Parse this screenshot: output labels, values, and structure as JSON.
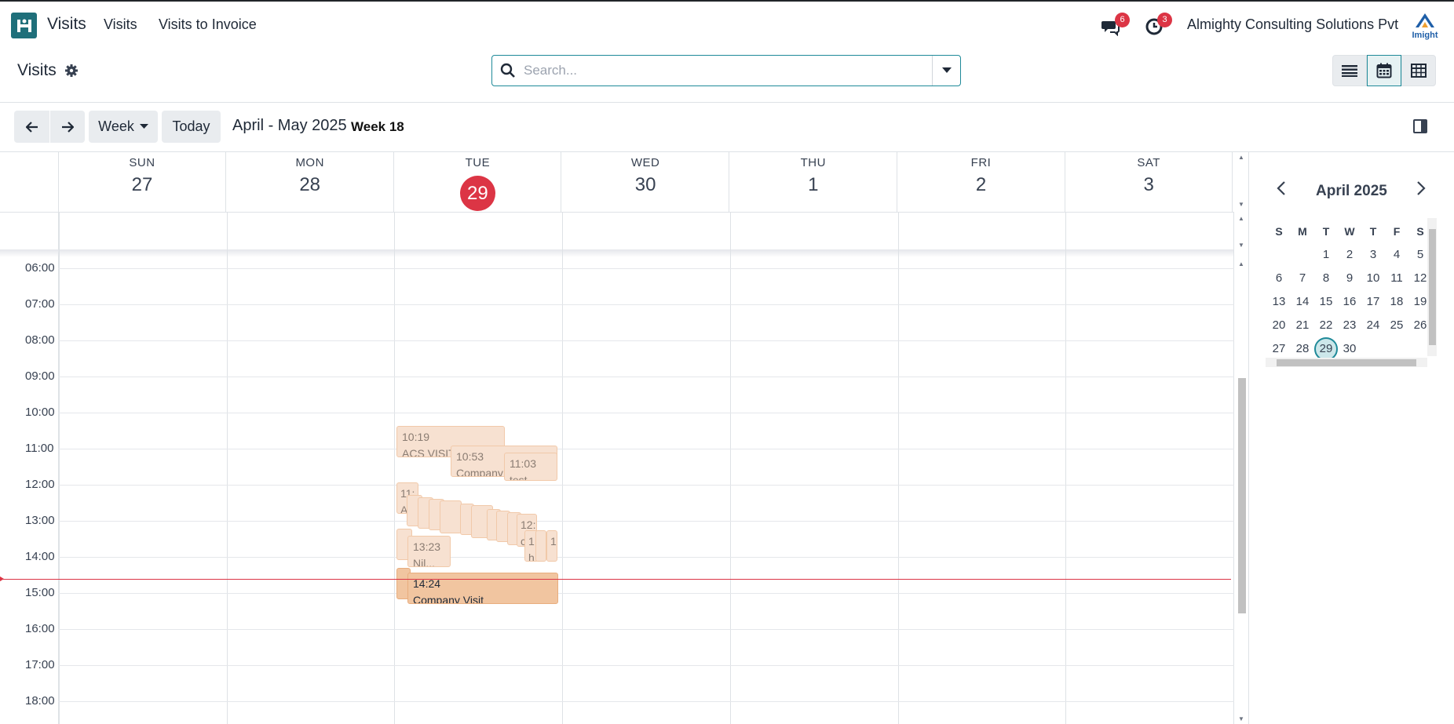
{
  "navbar": {
    "app_name": "Visits",
    "links": [
      "Visits",
      "Visits to Invoice"
    ],
    "messages_count": "6",
    "activities_count": "3",
    "company": "Almighty Consulting Solutions Pvt",
    "brand_text": "Imight"
  },
  "control_panel": {
    "title": "Visits",
    "search_placeholder": "Search..."
  },
  "toolbar": {
    "scale_label": "Week",
    "today_label": "Today",
    "range_title": "April - May 2025",
    "week_label": "Week 18"
  },
  "calendar": {
    "days": [
      {
        "name": "SUN",
        "num": "27"
      },
      {
        "name": "MON",
        "num": "28"
      },
      {
        "name": "TUE",
        "num": "29",
        "today": true
      },
      {
        "name": "WED",
        "num": "30"
      },
      {
        "name": "THU",
        "num": "1"
      },
      {
        "name": "FRI",
        "num": "2"
      },
      {
        "name": "SAT",
        "num": "3"
      }
    ],
    "hours": [
      "06:00",
      "07:00",
      "08:00",
      "09:00",
      "10:00",
      "11:00",
      "12:00",
      "13:00",
      "14:00",
      "15:00",
      "16:00",
      "17:00",
      "18:00"
    ],
    "events": {
      "e1_time": "10:19",
      "e1_title": "ACS VISIT",
      "e2_time": "10:53",
      "e2_title": "Company",
      "e3_time": "11:03",
      "e3_title": "test",
      "e4_time": "11:",
      "e4_title": "A",
      "e5_time": "13:23",
      "e5_title": "Nil...",
      "e6_time": "14:24",
      "e6_title": "Company Visit",
      "e7_time": "12:",
      "e7_title": "c",
      "e8_time": "1",
      "e8_title": "n",
      "e9_time": "1",
      "e9_title": "h"
    }
  },
  "mini_calendar": {
    "title": "April 2025",
    "dows": [
      "S",
      "M",
      "T",
      "W",
      "T",
      "F",
      "S"
    ],
    "weeks": [
      [
        "",
        "",
        "1",
        "2",
        "3",
        "4",
        "5"
      ],
      [
        "6",
        "7",
        "8",
        "9",
        "10",
        "11",
        "12"
      ],
      [
        "13",
        "14",
        "15",
        "16",
        "17",
        "18",
        "19"
      ],
      [
        "20",
        "21",
        "22",
        "23",
        "24",
        "25",
        "26"
      ],
      [
        "27",
        "28",
        "29",
        "30",
        "",
        "",
        ""
      ]
    ],
    "selected": "29"
  },
  "colors": {
    "accent": "#1f8a99",
    "today": "#dc3545",
    "event_fill": "#f7e1d1",
    "event_active": "#f1c5a0"
  }
}
